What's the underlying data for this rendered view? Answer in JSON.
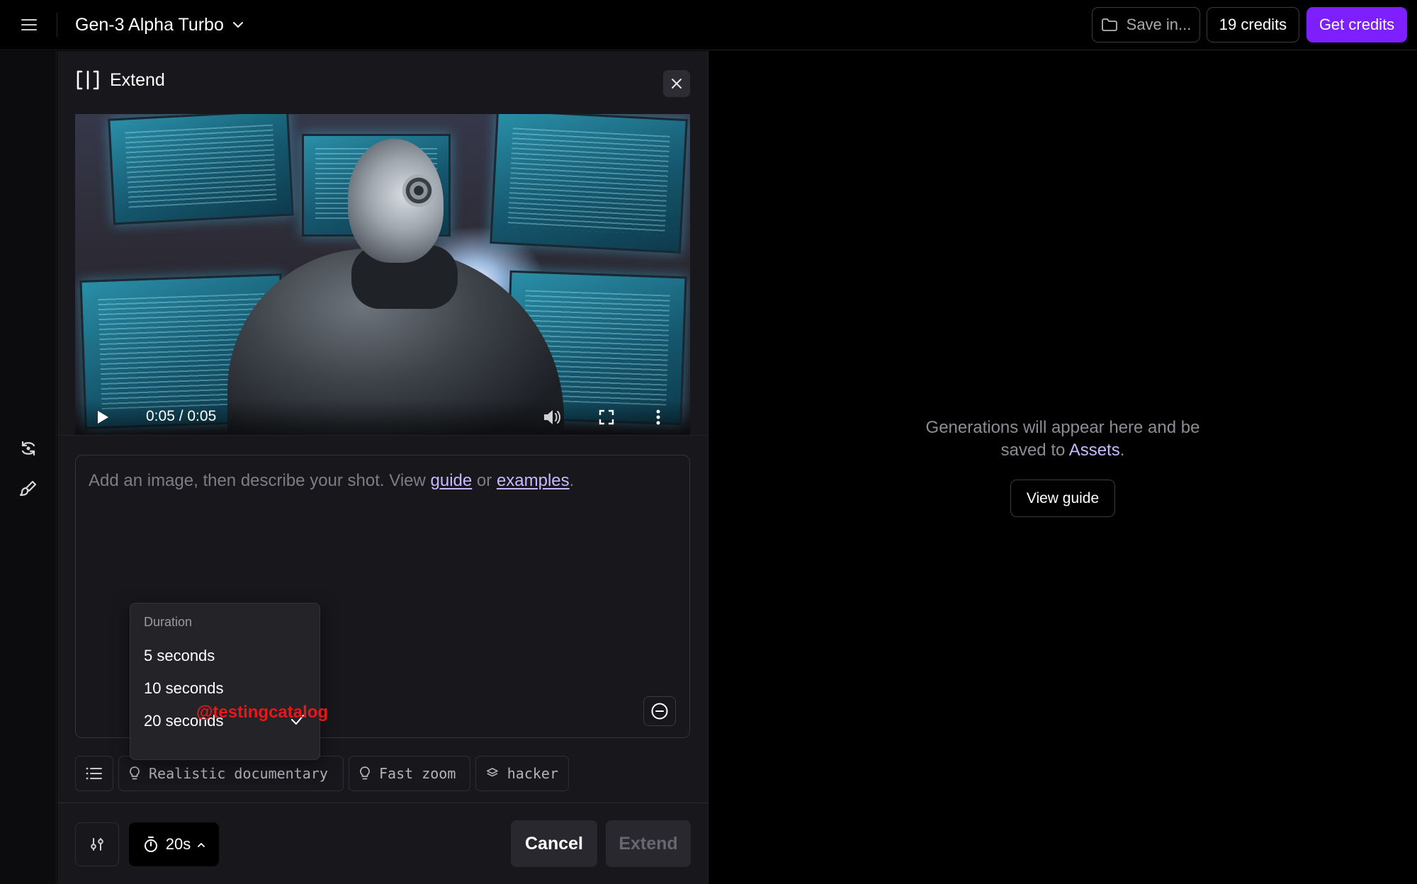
{
  "header": {
    "model_name": "Gen-3 Alpha Turbo",
    "save_label": "Save in...",
    "credits_label": "19 credits",
    "get_credits_label": "Get credits"
  },
  "panel": {
    "title": "Extend",
    "video": {
      "time": "0:05 / 0:05"
    },
    "prompt": {
      "placeholder_prefix": "Add an image, then describe your shot. View ",
      "guide_link": "guide",
      "or_text": " or ",
      "examples_link": "examples",
      "period": "."
    },
    "chips": [
      {
        "label": "Realistic documentary",
        "icon": "lightbulb-icon"
      },
      {
        "label": "Fast zoom",
        "icon": "lightbulb-icon"
      },
      {
        "label": "hacker",
        "icon": "layers-icon"
      }
    ],
    "duration_button_label": "20s",
    "cancel_label": "Cancel",
    "extend_label": "Extend"
  },
  "duration_menu": {
    "title": "Duration",
    "options": [
      "5 seconds",
      "10 seconds",
      "20 seconds"
    ],
    "selected": "20 seconds"
  },
  "watermark": "@testingcatalog",
  "empty_state": {
    "line1": "Generations will appear here and be",
    "line2_prefix": "saved to ",
    "assets_link": "Assets",
    "line2_suffix": ".",
    "view_guide_label": "View guide"
  },
  "colors": {
    "accent": "#7d1fff",
    "link": "#c9b8ff",
    "watermark": "#e8171a"
  }
}
